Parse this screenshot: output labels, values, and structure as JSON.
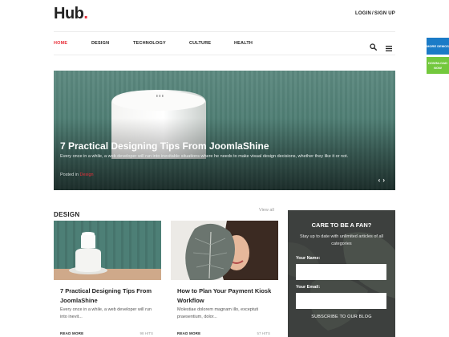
{
  "header": {
    "logo_text": "Hub",
    "logo_dot": ".",
    "login_label": "LOGIN",
    "login_sep": "/",
    "signup_label": "SIGN UP"
  },
  "nav": {
    "items": [
      {
        "label": "HOME",
        "active": true
      },
      {
        "label": "DESIGN",
        "active": false
      },
      {
        "label": "TECHNOLOGY",
        "active": false
      },
      {
        "label": "CULTURE",
        "active": false
      },
      {
        "label": "HEALTH",
        "active": false
      }
    ],
    "search_icon": "search-icon",
    "menu_icon": "hamburger-menu-icon"
  },
  "side_buttons": {
    "demos_label": "MORE DEMOS",
    "download_label": "DOWNLOAD NOW"
  },
  "hero": {
    "title": "7 Practical Designing Tips From JoomlaShine",
    "description": "Every once in a while, a web developer will run into inevitable situations where he needs to make visual design decisions, whether they like it or not.",
    "posted_prefix": "Posted in",
    "category": "Design",
    "prev_icon": "chevron-left-icon",
    "next_icon": "chevron-right-icon"
  },
  "section": {
    "title": "DESIGN",
    "view_all": "View all"
  },
  "cards": [
    {
      "title": "7 Practical Designing Tips From JoomlaShine",
      "excerpt": "Every once in a while, a web developer will run into inevit...",
      "read_more": "READ MORE",
      "hits": "98 HITS"
    },
    {
      "title": "How to Plan Your Payment Kiosk Workflow",
      "excerpt": "Molestiae dolorem magnam illo, exceptuti praesentium, dolor...",
      "read_more": "READ MORE",
      "hits": "57 HITS"
    }
  ],
  "fan_box": {
    "title": "CARE TO BE A FAN?",
    "description": "Stay up to date with unlimited articles of all categories",
    "name_label": "Your Name:",
    "email_label": "Your Email:",
    "subscribe_label": "SUBSCRIBE TO OUR BLOG"
  },
  "colors": {
    "accent": "#e8303a",
    "demos_blue": "#1b7bc7",
    "download_green": "#73c83d"
  }
}
